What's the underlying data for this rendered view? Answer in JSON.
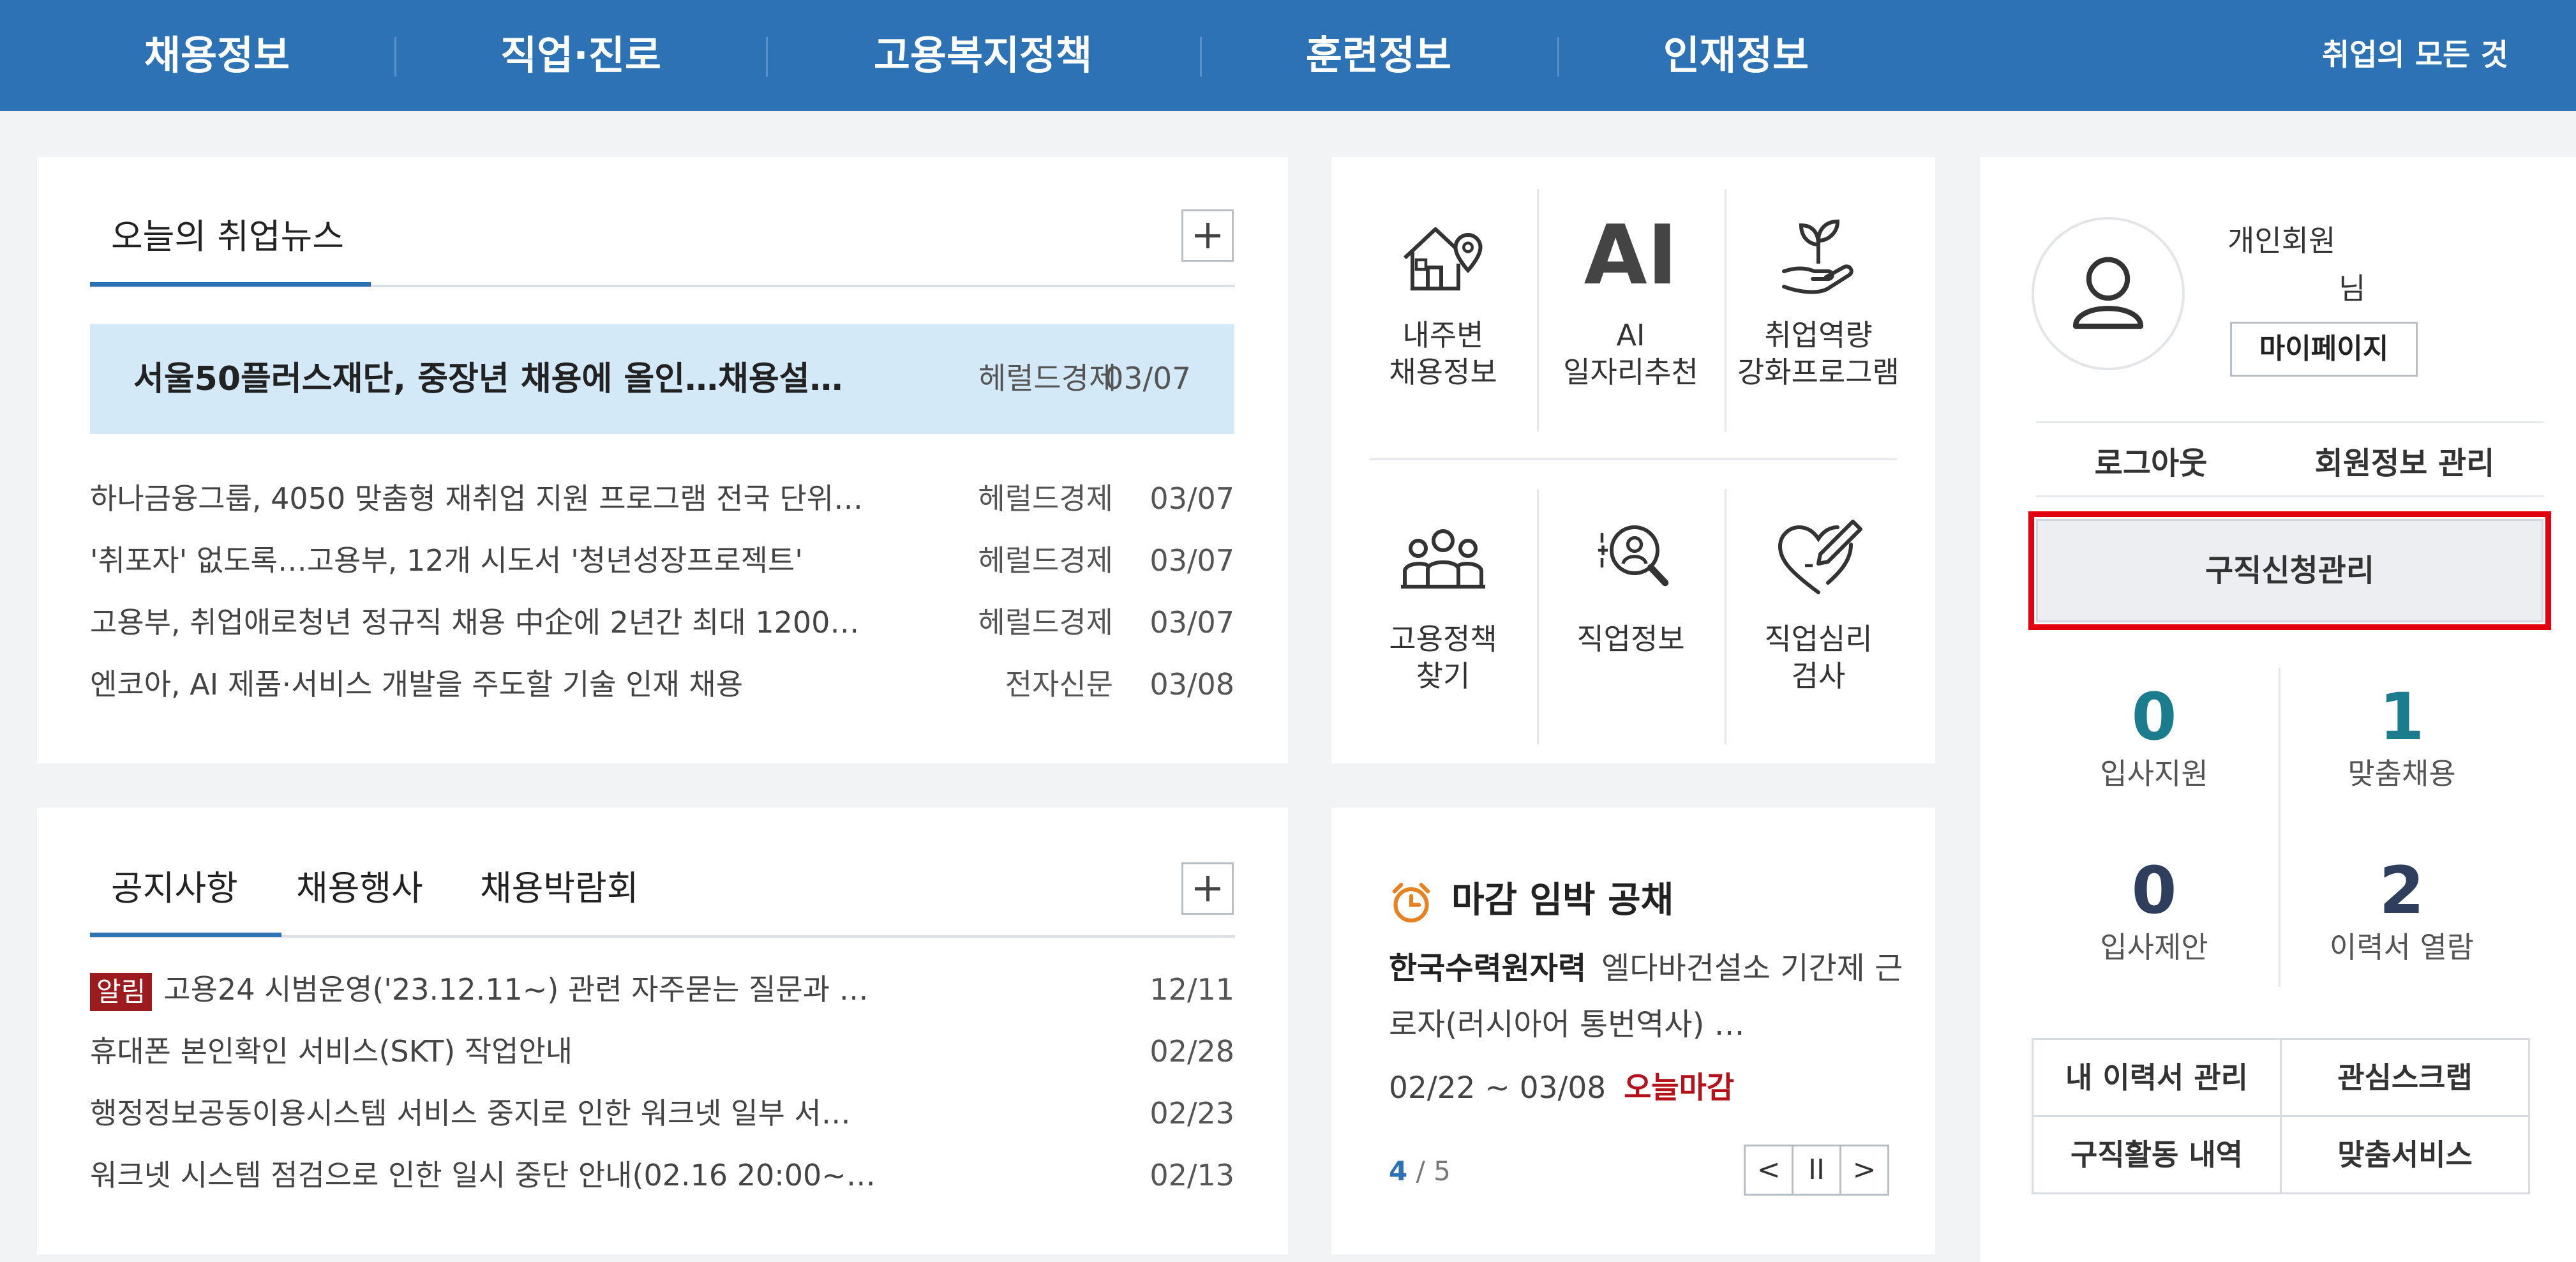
{
  "nav": {
    "items": [
      "채용정보",
      "직업·진로",
      "고용복지정책",
      "훈련정보",
      "인재정보"
    ],
    "all_label": "취업의 모든 것"
  },
  "news": {
    "title": "오늘의 취업뉴스",
    "headline": {
      "title": "서울50플러스재단, 중장년 채용에 올인…채용설…",
      "source": "헤럴드경제",
      "date": "03/07"
    },
    "items": [
      {
        "title": "하나금융그룹, 4050 맞춤형 재취업 지원 프로그램 전국 단위…",
        "source": "헤럴드경제",
        "date": "03/07"
      },
      {
        "title": "'취포자' 없도록…고용부, 12개 시도서 '청년성장프로젝트'",
        "source": "헤럴드경제",
        "date": "03/07"
      },
      {
        "title": "고용부, 취업애로청년 정규직 채용 中企에 2년간 최대 1200…",
        "source": "헤럴드경제",
        "date": "03/07"
      },
      {
        "title": "엔코아, AI 제품·서비스 개발을 주도할 기술 인재 채용",
        "source": "전자신문",
        "date": "03/08"
      }
    ]
  },
  "notice": {
    "tabs": [
      "공지사항",
      "채용행사",
      "채용박람회"
    ],
    "badge": "알림",
    "items": [
      {
        "title": "고용24 시범운영('23.12.11~) 관련 자주묻는 질문과 …",
        "date": "12/11"
      },
      {
        "title": "휴대폰 본인확인 서비스(SKT) 작업안내",
        "date": "02/28"
      },
      {
        "title": "행정정보공동이용시스템 서비스 중지로 인한 워크넷 일부 서…",
        "date": "02/23"
      },
      {
        "title": "워크넷 시스템 점검으로 인한 일시 중단 안내(02.16 20:00~…",
        "date": "02/13"
      }
    ]
  },
  "quick": {
    "ai_glyph": "AI",
    "items": [
      {
        "label": "내주변\n채용정보",
        "icon": "house-location-icon"
      },
      {
        "label": "AI\n일자리추천",
        "icon": "ai-icon"
      },
      {
        "label": "취업역량\n강화프로그램",
        "icon": "plant-hand-icon"
      },
      {
        "label": "고용정책\n찾기",
        "icon": "people-group-icon"
      },
      {
        "label": "직업정보",
        "icon": "person-search-icon"
      },
      {
        "label": "직업심리\n검사",
        "icon": "heart-pencil-icon"
      }
    ]
  },
  "deadline": {
    "title": "마감 임박 공채",
    "company": "한국수력원자력",
    "job": "엘다바건설소 기간제 근로자(러시아어 통번역사) …",
    "period": "02/22 ~ 03/08",
    "today_label": "오늘마감",
    "page_current": "4",
    "page_total": "/ 5",
    "prev": "<",
    "pause": "II",
    "next": ">"
  },
  "user": {
    "member_type": "개인회원",
    "honorific": "님",
    "mypage": "마이페이지",
    "logout": "로그아웃",
    "member_info": "회원정보 관리",
    "apply_manage": "구직신청관리",
    "stats": [
      {
        "value": "0",
        "label": "입사지원",
        "color": "#1a7c8c"
      },
      {
        "value": "1",
        "label": "맞춤채용",
        "color": "#1a7c8c"
      },
      {
        "value": "0",
        "label": "입사제안",
        "color": "#2e3e5c"
      },
      {
        "value": "2",
        "label": "이력서 열람",
        "color": "#2e3e5c"
      }
    ],
    "links": [
      "내 이력서 관리",
      "관심스크랩",
      "구직활동 내역",
      "맞춤서비스"
    ]
  },
  "colors": {
    "nav": "#2d72b5",
    "highlight": "#e3000f",
    "headline_bg": "#d4e9f8"
  }
}
